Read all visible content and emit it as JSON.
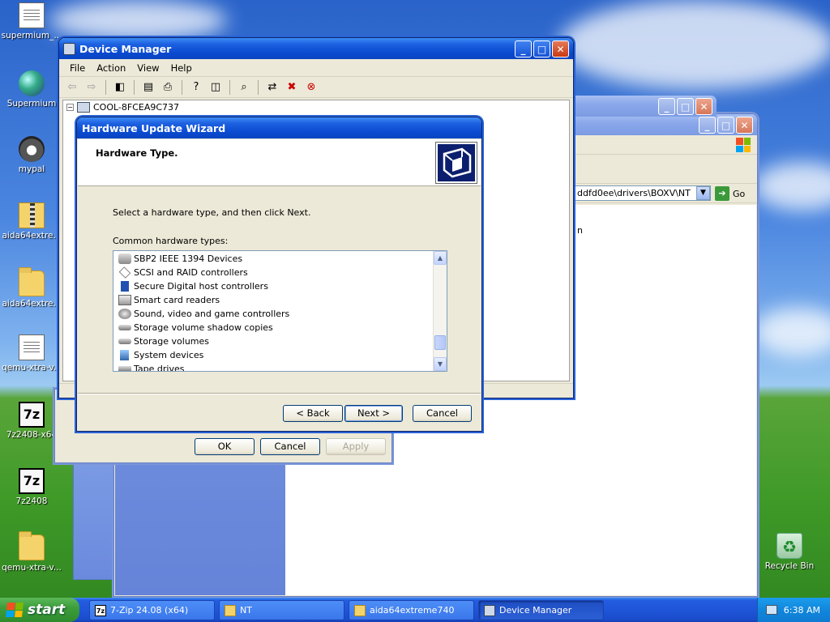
{
  "desktop": {
    "icons": [
      {
        "label": "supermium_..."
      },
      {
        "label": "Supermium"
      },
      {
        "label": "mypal"
      },
      {
        "label": "aida64extre..."
      },
      {
        "label": "aida64extre..."
      },
      {
        "label": "qemu-xtra-v..."
      },
      {
        "label": "7z2408-x64"
      },
      {
        "label": "7z2408"
      },
      {
        "label": "qemu-xtra-v..."
      },
      {
        "label": "Recycle Bin"
      }
    ]
  },
  "explorer": {
    "address_value": "ddfd0ee\\drivers\\BOXV\\NT",
    "go_label": "Go",
    "fragment": "n"
  },
  "properties": {
    "ok_label": "OK",
    "cancel_label": "Cancel",
    "apply_label": "Apply"
  },
  "device_manager": {
    "title": "Device Manager",
    "menu": [
      "File",
      "Action",
      "View",
      "Help"
    ],
    "tree_root": "COOL-8FCEA9C737"
  },
  "wizard": {
    "title": "Hardware Update Wizard",
    "heading": "Hardware Type.",
    "instruction": "Select a hardware type, and then click Next.",
    "list_label": "Common hardware types:",
    "items": [
      "SBP2 IEEE 1394 Devices",
      "SCSI and RAID controllers",
      "Secure Digital host controllers",
      "Smart card readers",
      "Sound, video and game controllers",
      "Storage volume shadow copies",
      "Storage volumes",
      "System devices",
      "Tape drives"
    ],
    "back_label": "< Back",
    "next_label": "Next >",
    "cancel_label": "Cancel"
  },
  "taskbar": {
    "start_label": "start",
    "tasks": [
      {
        "label": "7-Zip 24.08 (x64)"
      },
      {
        "label": "NT"
      },
      {
        "label": "aida64extreme740"
      },
      {
        "label": "Device Manager"
      }
    ],
    "clock": "6:38 AM"
  }
}
